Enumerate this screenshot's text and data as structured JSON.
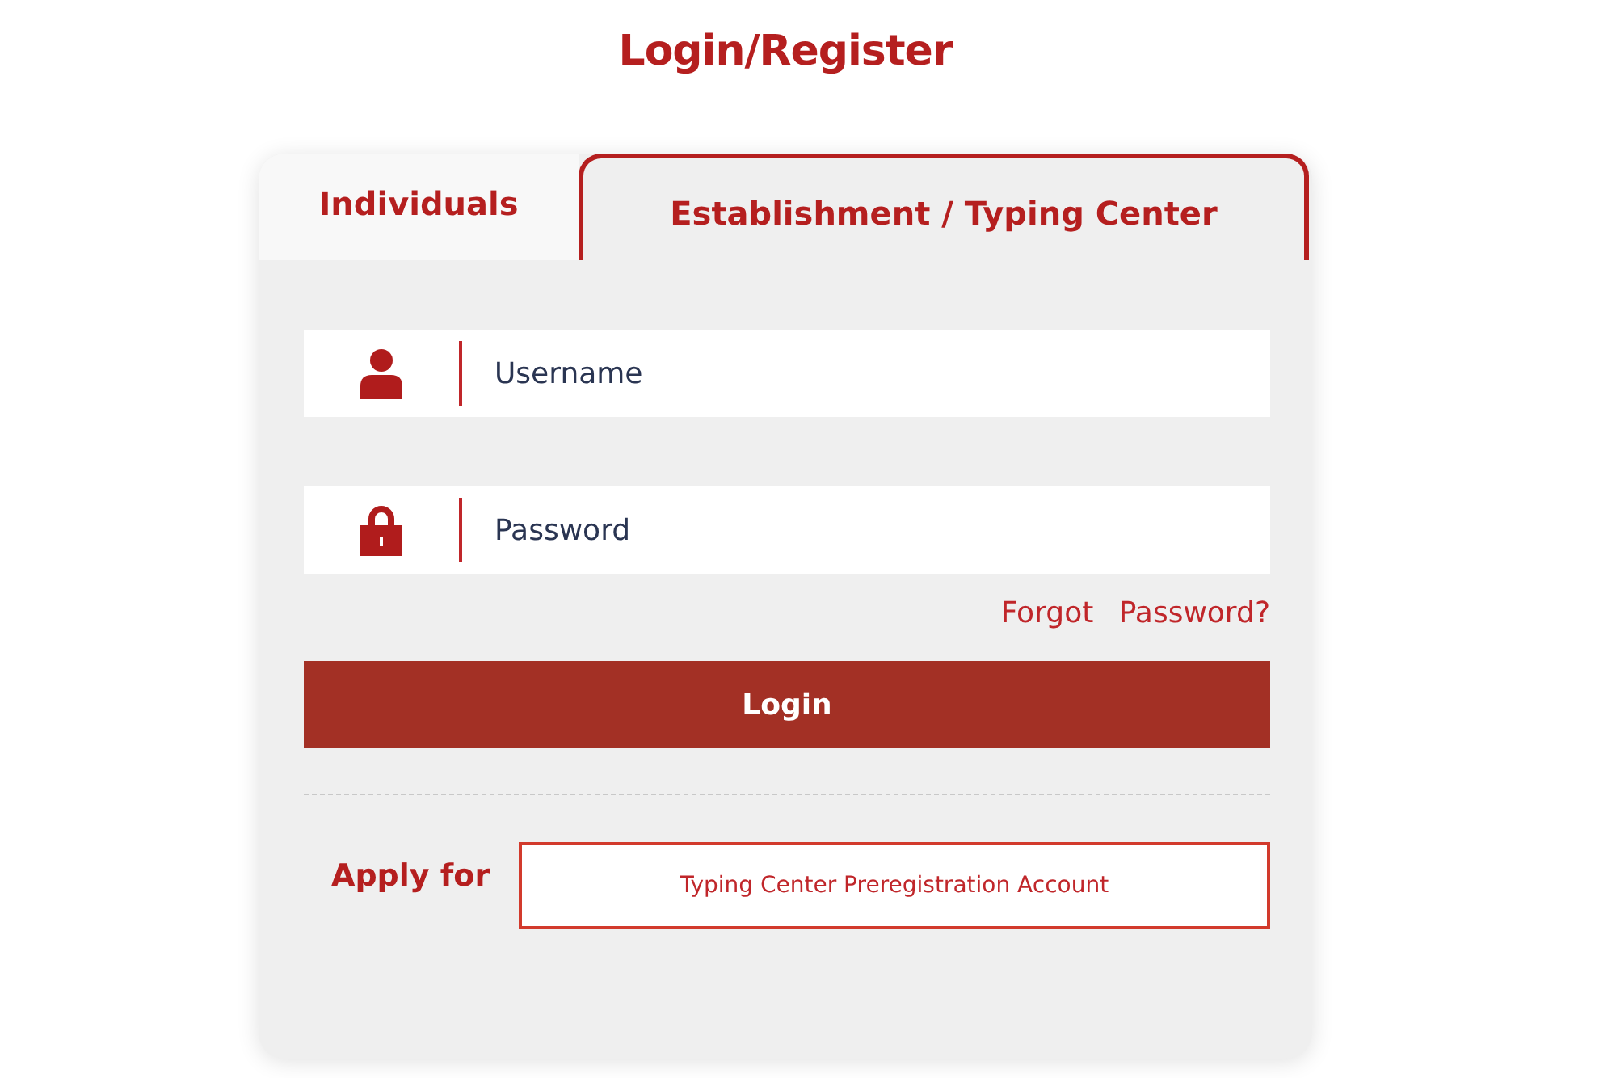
{
  "title": "Login/Register",
  "tabs": [
    {
      "label": "Individuals",
      "selected": false
    },
    {
      "label": "Establishment  / Typing Center",
      "selected": true
    }
  ],
  "fields": [
    {
      "kind": "user",
      "placeholder": "Username"
    },
    {
      "kind": "lock",
      "placeholder": "Password"
    }
  ],
  "forgot_link": "Forgot Password?",
  "login_button": "Login",
  "apply": {
    "label": "Apply for",
    "button": "Typing Center Preregistration Account"
  }
}
